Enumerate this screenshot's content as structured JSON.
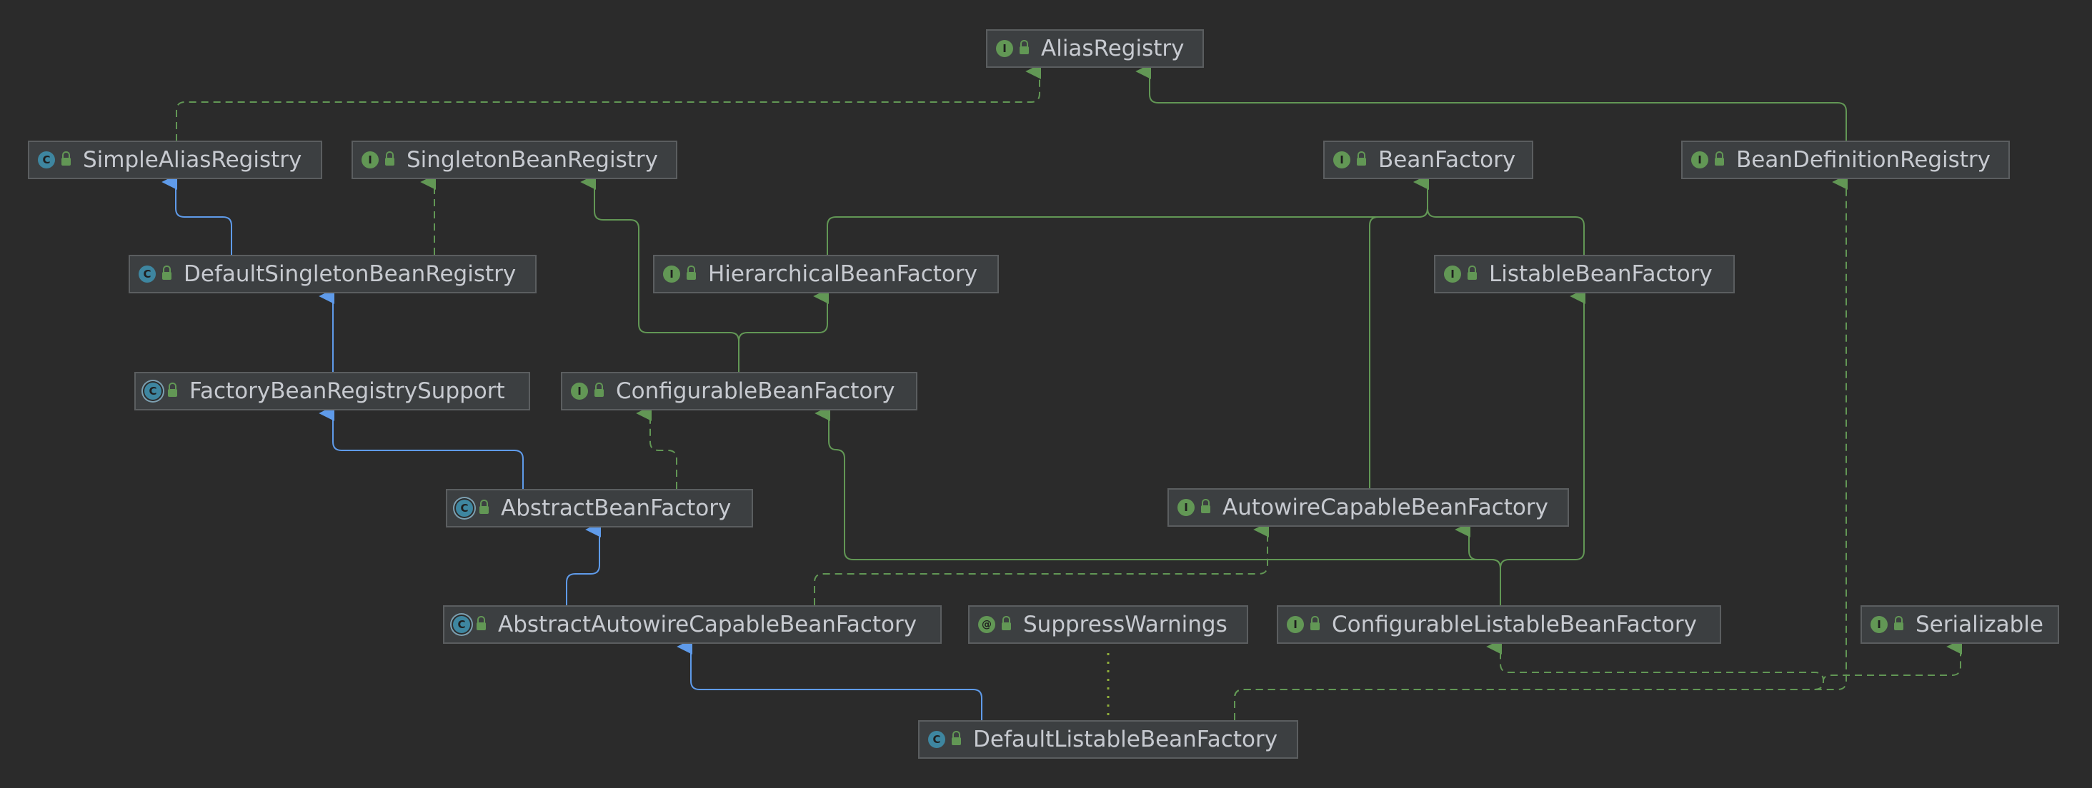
{
  "colors": {
    "background": "#2b2b2b",
    "node_fill": "#3c3f41",
    "node_border": "#5b5e60",
    "text": "#c7cad0",
    "interface_badge": "#629755",
    "class_badge": "#3e86a0",
    "extends_edge": "#5f9bea",
    "implements_edge": "#629755",
    "annotation_edge": "#8fae3b"
  },
  "legend_kinds": {
    "interface": "I",
    "class": "C",
    "abstract": "C",
    "annotation": "@"
  },
  "nodes": [
    {
      "id": "AliasRegistry",
      "label": "AliasRegistry",
      "kind": "interface"
    },
    {
      "id": "SimpleAliasRegistry",
      "label": "SimpleAliasRegistry",
      "kind": "class"
    },
    {
      "id": "SingletonBeanRegistry",
      "label": "SingletonBeanRegistry",
      "kind": "interface"
    },
    {
      "id": "BeanFactory",
      "label": "BeanFactory",
      "kind": "interface"
    },
    {
      "id": "BeanDefinitionRegistry",
      "label": "BeanDefinitionRegistry",
      "kind": "interface"
    },
    {
      "id": "DefaultSingletonBeanRegistry",
      "label": "DefaultSingletonBeanRegistry",
      "kind": "class"
    },
    {
      "id": "HierarchicalBeanFactory",
      "label": "HierarchicalBeanFactory",
      "kind": "interface"
    },
    {
      "id": "ListableBeanFactory",
      "label": "ListableBeanFactory",
      "kind": "interface"
    },
    {
      "id": "FactoryBeanRegistrySupport",
      "label": "FactoryBeanRegistrySupport",
      "kind": "abstract"
    },
    {
      "id": "ConfigurableBeanFactory",
      "label": "ConfigurableBeanFactory",
      "kind": "interface"
    },
    {
      "id": "AbstractBeanFactory",
      "label": "AbstractBeanFactory",
      "kind": "abstract"
    },
    {
      "id": "AutowireCapableBeanFactory",
      "label": "AutowireCapableBeanFactory",
      "kind": "interface"
    },
    {
      "id": "AbstractAutowireCapableBeanFactory",
      "label": "AbstractAutowireCapableBeanFactory",
      "kind": "abstract"
    },
    {
      "id": "SuppressWarnings",
      "label": "SuppressWarnings",
      "kind": "annotation"
    },
    {
      "id": "ConfigurableListableBeanFactory",
      "label": "ConfigurableListableBeanFactory",
      "kind": "interface"
    },
    {
      "id": "Serializable",
      "label": "Serializable",
      "kind": "interface"
    },
    {
      "id": "DefaultListableBeanFactory",
      "label": "DefaultListableBeanFactory",
      "kind": "class"
    }
  ],
  "edges": [
    {
      "from": "SimpleAliasRegistry",
      "to": "AliasRegistry",
      "type": "implements"
    },
    {
      "from": "BeanDefinitionRegistry",
      "to": "AliasRegistry",
      "type": "extends-interface"
    },
    {
      "from": "DefaultSingletonBeanRegistry",
      "to": "SimpleAliasRegistry",
      "type": "extends"
    },
    {
      "from": "DefaultSingletonBeanRegistry",
      "to": "SingletonBeanRegistry",
      "type": "implements"
    },
    {
      "from": "HierarchicalBeanFactory",
      "to": "BeanFactory",
      "type": "extends-interface"
    },
    {
      "from": "ListableBeanFactory",
      "to": "BeanFactory",
      "type": "extends-interface"
    },
    {
      "from": "AutowireCapableBeanFactory",
      "to": "BeanFactory",
      "type": "extends-interface"
    },
    {
      "from": "FactoryBeanRegistrySupport",
      "to": "DefaultSingletonBeanRegistry",
      "type": "extends"
    },
    {
      "from": "ConfigurableBeanFactory",
      "to": "SingletonBeanRegistry",
      "type": "extends-interface"
    },
    {
      "from": "ConfigurableBeanFactory",
      "to": "HierarchicalBeanFactory",
      "type": "extends-interface"
    },
    {
      "from": "AbstractBeanFactory",
      "to": "FactoryBeanRegistrySupport",
      "type": "extends"
    },
    {
      "from": "AbstractBeanFactory",
      "to": "ConfigurableBeanFactory",
      "type": "implements"
    },
    {
      "from": "AbstractAutowireCapableBeanFactory",
      "to": "AbstractBeanFactory",
      "type": "extends"
    },
    {
      "from": "AbstractAutowireCapableBeanFactory",
      "to": "AutowireCapableBeanFactory",
      "type": "implements"
    },
    {
      "from": "ConfigurableListableBeanFactory",
      "to": "ConfigurableBeanFactory",
      "type": "extends-interface"
    },
    {
      "from": "ConfigurableListableBeanFactory",
      "to": "AutowireCapableBeanFactory",
      "type": "extends-interface"
    },
    {
      "from": "ConfigurableListableBeanFactory",
      "to": "ListableBeanFactory",
      "type": "extends-interface"
    },
    {
      "from": "DefaultListableBeanFactory",
      "to": "AbstractAutowireCapableBeanFactory",
      "type": "extends"
    },
    {
      "from": "DefaultListableBeanFactory",
      "to": "SuppressWarnings",
      "type": "annotated"
    },
    {
      "from": "DefaultListableBeanFactory",
      "to": "ConfigurableListableBeanFactory",
      "type": "implements"
    },
    {
      "from": "DefaultListableBeanFactory",
      "to": "BeanDefinitionRegistry",
      "type": "implements"
    },
    {
      "from": "DefaultListableBeanFactory",
      "to": "Serializable",
      "type": "implements"
    }
  ]
}
